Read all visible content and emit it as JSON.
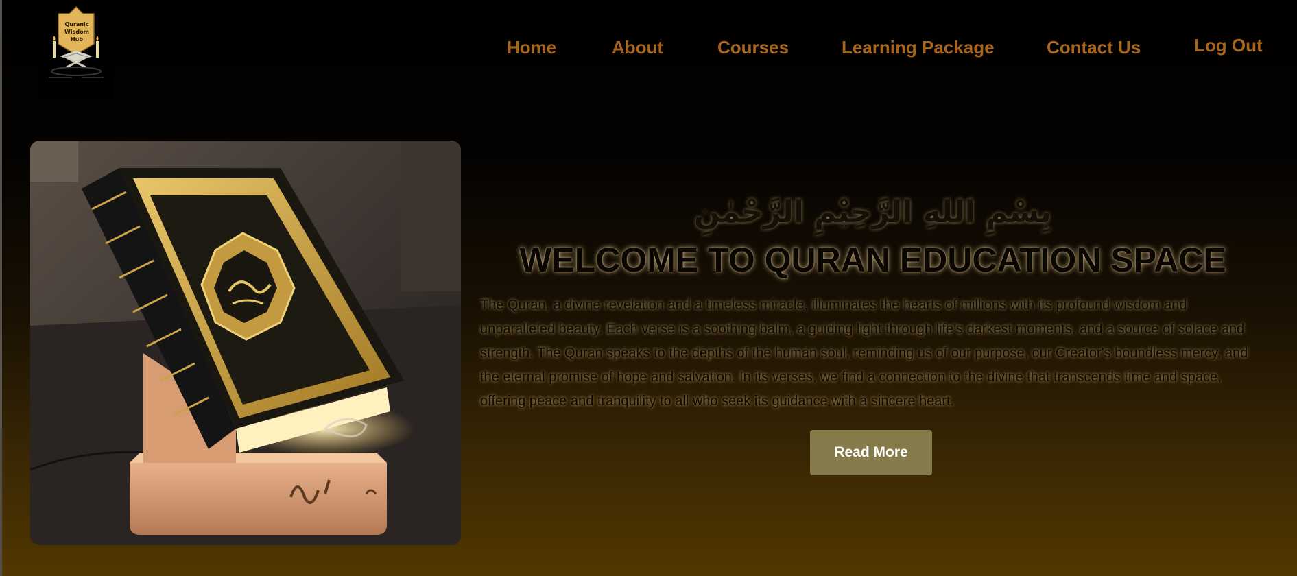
{
  "brand": {
    "logo_lines": [
      "Quranic",
      "Wisdom",
      "Hub"
    ]
  },
  "nav": {
    "home": "Home",
    "about": "About",
    "courses": "Courses",
    "learning_package": "Learning Package",
    "contact_us": "Contact Us",
    "logout": "Log Out"
  },
  "hero": {
    "bismillah": "بِسْمِ اللهِ الرَّحِيْمِ الرَّحْمٰنِ",
    "title": "WELCOME TO QURAN EDUCATION SPACE",
    "description": "The Quran, a divine revelation and a timeless miracle, illuminates the hearts of millions with its profound wisdom and unparalleled beauty. Each verse is a soothing balm, a guiding light through life's darkest moments, and a source of solace and strength. The Quran speaks to the depths of the human soul, reminding us of our purpose, our Creator's boundless mercy, and the eternal promise of hope and salvation. In its verses, we find a connection to the divine that transcends time and space, offering peace and tranquility to all who seek its guidance with a sincere heart.",
    "read_more": "Read More"
  },
  "colors": {
    "nav_link": "#a8651c",
    "button_bg": "#857a4a",
    "gold": "#d8b25a"
  }
}
